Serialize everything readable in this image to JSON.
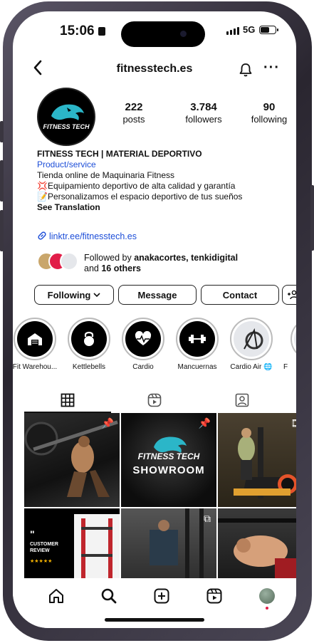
{
  "status": {
    "time": "15:06",
    "network": "5G"
  },
  "header": {
    "handle": "fitnesstech.es"
  },
  "profile": {
    "avatar_text": "FITNESS TECH",
    "stats": [
      {
        "value": "222",
        "label": "posts"
      },
      {
        "value": "3.784",
        "label": "followers"
      },
      {
        "value": "90",
        "label": "following"
      }
    ],
    "name": "FITNESS TECH | MATERIAL DEPORTIVO",
    "category": "Product/service",
    "bio_lines": [
      "Tienda online de Maquinaria Fitness",
      "💢Equipamiento deportivo de alta calidad y garantía",
      "📝Personalizamos el espacio deportivo de tus sueños"
    ],
    "see_translation": "See Translation",
    "link": "linktr.ee/fitnesstech.es",
    "followed_prefix": "Followed by ",
    "followed_names": "anakacortes, tenkidigital",
    "followed_and": "and ",
    "followed_others": "16 others"
  },
  "actions": {
    "following": "Following",
    "message": "Message",
    "contact": "Contact"
  },
  "highlights": [
    {
      "label": "Fit Warehou...",
      "icon": "warehouse-icon"
    },
    {
      "label": "Kettlebells",
      "icon": "kettlebell-icon"
    },
    {
      "label": "Cardio",
      "icon": "heart-icon"
    },
    {
      "label": "Mancuernas",
      "icon": "dumbbell-icon"
    },
    {
      "label": "Cardio Air 🌐",
      "icon": "bike-photo"
    },
    {
      "label": "F",
      "icon": "partial"
    }
  ],
  "posts": {
    "showroom_brand": "FITNESS TECH",
    "showroom_title": "SHOWROOM",
    "review_title": "CUSTOMER REVIEW",
    "review_quote": "\""
  },
  "colors": {
    "link": "#1d4ed8",
    "accent_teal": "#2bb6c8",
    "notification": "#e11d48"
  }
}
